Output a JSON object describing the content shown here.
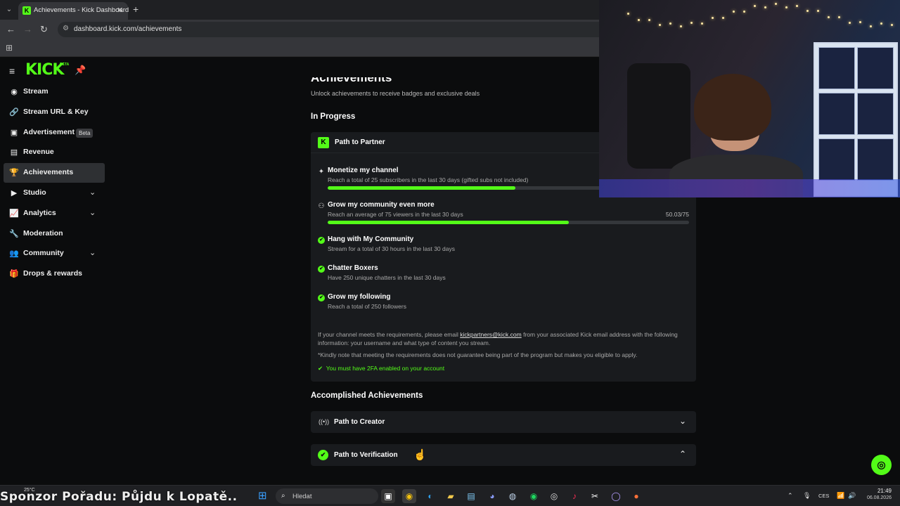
{
  "browser": {
    "tab_title": "Achievements - Kick Dashboard",
    "tab_favicon": "K",
    "url": "dashboard.kick.com/achievements"
  },
  "sidebar": {
    "logo": "KICK",
    "logo_badge": "BETA",
    "items": [
      {
        "label": "Stream",
        "icon": "stream-icon",
        "glyph": "((•))"
      },
      {
        "label": "Stream URL & Key",
        "icon": "link-icon",
        "glyph": "🔗"
      },
      {
        "label": "Advertisement",
        "icon": "ad-icon",
        "glyph": "▣",
        "badge": "Beta"
      },
      {
        "label": "Revenue",
        "icon": "revenue-icon",
        "glyph": "▤"
      },
      {
        "label": "Achievements",
        "icon": "trophy-icon",
        "glyph": "🏆",
        "active": true
      },
      {
        "label": "Studio",
        "icon": "studio-icon",
        "glyph": "▶",
        "expandable": true
      },
      {
        "label": "Analytics",
        "icon": "analytics-icon",
        "glyph": "📈",
        "expandable": true
      },
      {
        "label": "Moderation",
        "icon": "wrench-icon",
        "glyph": "🔧"
      },
      {
        "label": "Community",
        "icon": "community-icon",
        "glyph": "👥",
        "expandable": true
      },
      {
        "label": "Drops & rewards",
        "icon": "gift-icon",
        "glyph": "🎁"
      }
    ]
  },
  "main": {
    "title": "Achievements",
    "subtitle": "Unlock achievements to receive badges and exclusive deals",
    "in_progress_title": "In Progress",
    "partner_card": {
      "title": "Path to Partner",
      "requirements": [
        {
          "title": "Monetize my channel",
          "desc": "Reach a total of 25 subscribers in the last 30 days (gifted subs not included)",
          "progress": 0.52,
          "status": "in-progress"
        },
        {
          "title": "Grow my community even more",
          "desc": "Reach an average of 75 viewers in the last 30 days",
          "progress": 0.667,
          "progress_text": "50.03/75",
          "status": "in-progress"
        },
        {
          "title": "Hang with My Community",
          "desc": "Stream for a total of 30 hours in the last 30 days",
          "status": "done"
        },
        {
          "title": "Chatter Boxers",
          "desc": "Have 250 unique chatters in the last 30 days",
          "status": "done"
        },
        {
          "title": "Grow my following",
          "desc": "Reach a total of 250 followers",
          "status": "done"
        }
      ],
      "note_pre": "If your channel meets the requirements, please email ",
      "note_email": "kickpartners@kick.com",
      "note_post": " from your associated Kick email address with the following information: your username and what type of content you stream.",
      "note_disclaimer": "*Kindly note that meeting the requirements does not guarantee being part of the program but makes you eligible to apply.",
      "twofa": "You must have 2FA enabled on your account"
    },
    "accomplished_title": "Accomplished Achievements",
    "accomplished": [
      {
        "title": "Path to Creator",
        "icon": "broadcast-icon",
        "expanded": false
      },
      {
        "title": "Path to Verification",
        "icon": "verified-badge-icon",
        "expanded": true
      }
    ]
  },
  "taskbar": {
    "weather": "25°C",
    "overlay_text": "Sponzor Pořadu: Půjdu k Lopatě..",
    "search_placeholder": "Hledat",
    "language": "CES",
    "time": "21:49",
    "date": "06.08.2026"
  },
  "colors": {
    "accent": "#53fc18",
    "background": "#0b0c0d",
    "card": "#191b1e"
  }
}
